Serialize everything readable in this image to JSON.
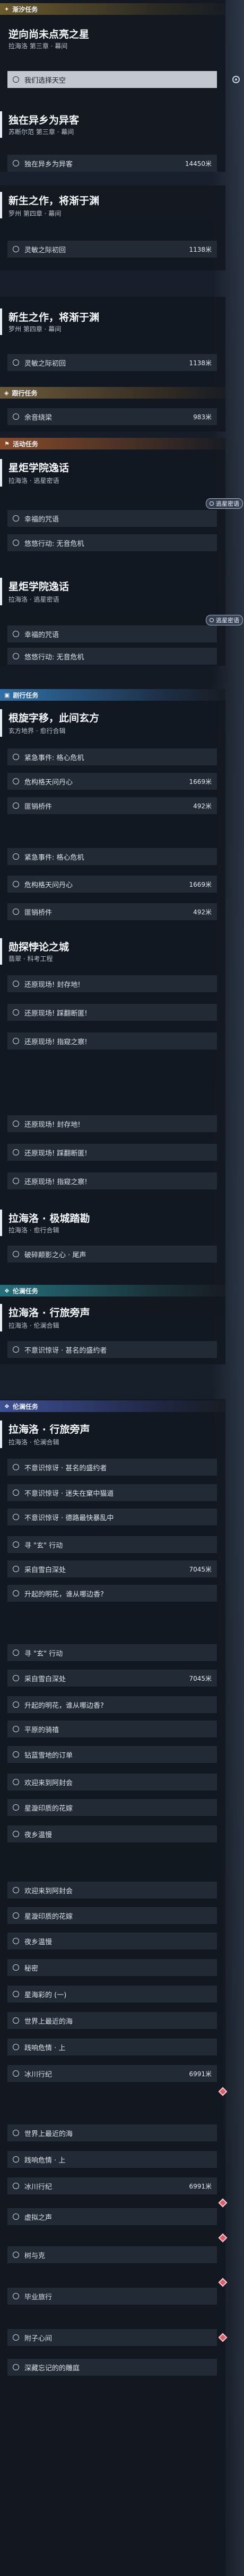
{
  "headers": {
    "h1": "渐汐任务",
    "h2": "跟行任务",
    "h3": "活动任务",
    "h4": "剧行任务",
    "h5": "伦澜任务",
    "h6": "伦澜任务"
  },
  "quests": {
    "q1": {
      "title": "逆向尚未点亮之星",
      "sub": "拉海洛 第三章 · 幕间"
    },
    "q2": {
      "title": "独在异乡为异客",
      "sub": "苏断尔范 第三章 · 幕间"
    },
    "q3": {
      "title": "新生之作，将渐于渊",
      "sub": "罗州 第四章 · 幕间"
    },
    "q4": {
      "title": "新生之作，将渐于渊",
      "sub": "罗州 第四章 · 幕间"
    },
    "q5": {
      "title": "星炬学院逸话",
      "sub": "拉海洛 · 逃星密语"
    },
    "q6": {
      "title": "星炬学院逸话",
      "sub": "拉海洛 · 逃星密语"
    },
    "q7": {
      "title": "根旋字移，此间玄方",
      "sub": "玄方地界 · 愈行合辑"
    },
    "q8": {
      "title": "勋探悖论之城",
      "sub": "翡翠 · 科考工程"
    },
    "q9": {
      "title": "拉海洛 · 极城踏勘",
      "sub": "拉海洛 · 愈行合辑"
    },
    "q10": {
      "title": "拉海洛 · 行旅旁声",
      "sub": "拉海洛 · 伦澜合辑"
    },
    "q11": {
      "title": "拉海洛 · 行旅旁声",
      "sub": "拉海洛 · 伦澜合辑"
    }
  },
  "rows": {
    "r1": "我们选择天空",
    "r2": "独在异乡为异客",
    "r3": "灵敏之际初回",
    "r4": "灵敏之际初回",
    "r5": "余音绕梁",
    "r6": "幸福的咒语",
    "r7": "悠悠行动: 无音危机",
    "r8": "幸福的咒语",
    "r9": "悠悠行动: 无音危机",
    "r10": "紧急事件: 格心危机",
    "r11": "危构格天问丹心",
    "r12": "匪销桥件",
    "r13": "紧急事件: 格心危机",
    "r14": "危构格天问丹心",
    "r15": "匪销桥件",
    "r16": "还原现场! 封存地!",
    "r17": "还原现场! 踩翻断匿!",
    "r18": "还原现场! 指窥之察!",
    "r19": "还原现场! 封存地!",
    "r20": "还原现场! 踩翻断匿!",
    "r21": "还原现场! 指窥之察!",
    "r22": "破碎颠影之心 · 尾声",
    "r23": "不意识惊讶 · 甚名的盛约者",
    "r24": "不意识惊讶 · 甚名的盛约者",
    "r25": "不意识惊讶 · 迷失在窠中猫道",
    "r26": "不意识惊讶 · 德路最快暴乱中",
    "r27": "寻 \"玄\" 行动",
    "r28": "采自雪白深处",
    "r29": "升起的明花，谁从哪边香?",
    "r30": "寻 \"玄\" 行动",
    "r31": "采自雪白深处",
    "r32": "升起的明花，谁从哪边香?",
    "r33": "平原的骑禧",
    "r34": "钻蓝雪地的订单",
    "r35": "欢迎来到阿封会",
    "r36": "星漩印质的花嫁",
    "r37": "夜乡温慢",
    "r38": "欢迎来到阿封会",
    "r39": "星漩印质的花嫁",
    "r40": "夜乡温慢",
    "r41": "秘密",
    "r42": "星海彩的 (一)",
    "r43": "世界上最近的海",
    "r44": "践响危情 · 上",
    "r45": "冰川行纪",
    "r46": "世界上最近的海",
    "r47": "践响危情 · 上",
    "r48": "冰川行纪",
    "r49": "虚拟之声",
    "r50": "树与克",
    "r51": "毕业旅行",
    "r52": "附子心间",
    "r53": "深藏忘记的的雕庭"
  },
  "distances": {
    "d1": "14450米",
    "d2": "1138米",
    "d3": "1138米",
    "d4": "983米",
    "d5": "1669米",
    "d6": "492米",
    "d7": "1669米",
    "d8": "492米",
    "d9": "7045米",
    "d10": "7045米",
    "d11": "6991米",
    "d12": "6991米"
  },
  "follow_label": "逃星密语"
}
